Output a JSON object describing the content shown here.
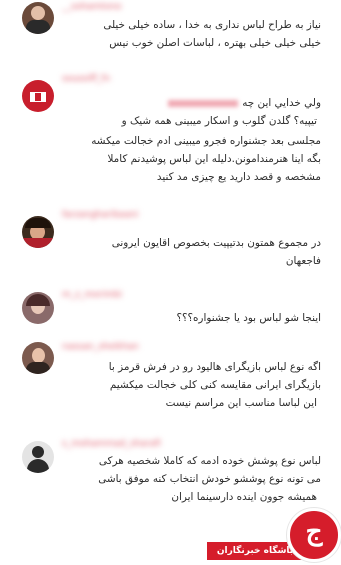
{
  "comments": [
    {
      "username": "__sohamtono",
      "lines": [
        "نیاز به طراح لباس نداری به خدا ، ساده خیلی خیلی",
        "خیلی خیلی خیلی بهتره ، لباسات اصلن خوب نیس"
      ]
    },
    {
      "username": "sousoiff_fn",
      "lines": [
        "ولي خدايي اين چه",
        "تیپیه؟ گلدن گلوب و اسکار میبینی همه شیک و",
        "مجلسی بعد جشنواره فجرو میبینی ادم خجالت میکشه",
        "بگه اینا هنرمندامونن.دلیله این لباس پوشیدنم کاملا",
        "مشخصه و قصد دارید یع چیزی مد کنید"
      ]
    },
    {
      "username": "farzangharibaani",
      "lines": [
        "در مجموع همتون بدتیپیت بخصوص اقایون ایرونی",
        "فاجعهان"
      ]
    },
    {
      "username": "m_z_morimbi",
      "lines": [
        "اینجا شو لباس بود یا جشنواره؟؟؟"
      ]
    },
    {
      "username": "nassan_sheikhan",
      "lines": [
        "اگه نوع لباس بازیگرای هالیود رو در فرش قرمز با",
        "بازیگرای ایرانی مقایسه کنی کلی خجالت میکشیم",
        "این لباسا مناسب این مراسم نیست"
      ]
    },
    {
      "username": "s_mohammad_sharafi",
      "lines": [
        "لباس نوع پوشش خوده ادمه که کاملا شخصیه هرکی",
        "می تونه نوع پوششو خودش انتخاب کنه موفق باشی",
        "همیشه جوون اینده دارسینما ایران"
      ]
    }
  ],
  "logo": {
    "glyph": "ج",
    "label": "باشگاه خبرنگاران"
  },
  "colors": {
    "brand_red": "#d51d2b",
    "username_blur": "#e05a6a",
    "text": "#2b2b2b"
  }
}
